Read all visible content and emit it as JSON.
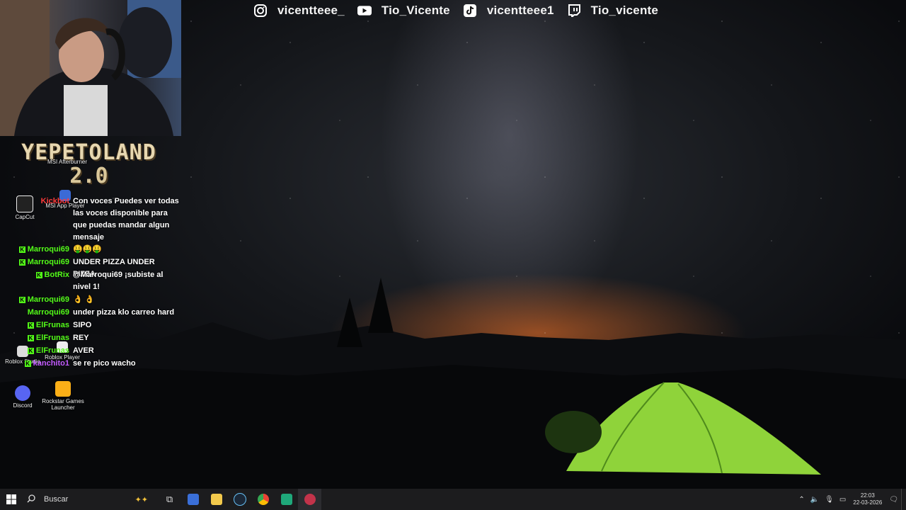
{
  "socials": [
    {
      "icon": "instagram-icon",
      "handle": "vicentteee_"
    },
    {
      "icon": "youtube-icon",
      "handle": "Tio_Vicente"
    },
    {
      "icon": "tiktok-icon",
      "handle": "vicentteee1"
    },
    {
      "icon": "twitch-icon",
      "handle": "Tio_vicente"
    }
  ],
  "overlay_logo": {
    "line1": "YEPETOLAND",
    "line2": "2.0"
  },
  "desktop_icons": [
    {
      "label": "CapCut"
    },
    {
      "label": "MSI Afterburner"
    },
    {
      "label": "MSI App Player"
    },
    {
      "label": "Roblox Studio"
    },
    {
      "label": "Roblox Player"
    },
    {
      "label": "Discord"
    },
    {
      "label": "Rockstar Games Launcher"
    }
  ],
  "chat": [
    {
      "user": "Kickbot",
      "color": "#ff3b3b",
      "text": "Con voces Puedes ver todas las voces disponible para que puedas mandar algun mensaje"
    },
    {
      "user": "Marroqui69",
      "color": "#53fc18",
      "text": "🤑🤑🤑"
    },
    {
      "user": "Marroqui69",
      "color": "#53fc18",
      "text": "UNDER PIZZA UNDER PIZZA"
    },
    {
      "user": "BotRix",
      "color": "#53fc18",
      "text": "@Marroqui69 ¡subiste al nivel 1!"
    },
    {
      "user": "Marroqui69",
      "color": "#53fc18",
      "text": "👌 👌"
    },
    {
      "user": "Marroqui69",
      "color": "#53fc18",
      "text": "under pizza klo carreo hard"
    },
    {
      "user": "ElFrunas",
      "color": "#53fc18",
      "text": "SIPO"
    },
    {
      "user": "ElFrunas",
      "color": "#53fc18",
      "text": "REY"
    },
    {
      "user": "ElFrunas",
      "color": "#53fc18",
      "text": "AVER"
    },
    {
      "user": "kanchito1",
      "color": "#c35bff",
      "text": "se re pico wacho"
    }
  ],
  "taskbar": {
    "search_placeholder": "Buscar",
    "time": "22:03",
    "date": "22-03-2026"
  }
}
